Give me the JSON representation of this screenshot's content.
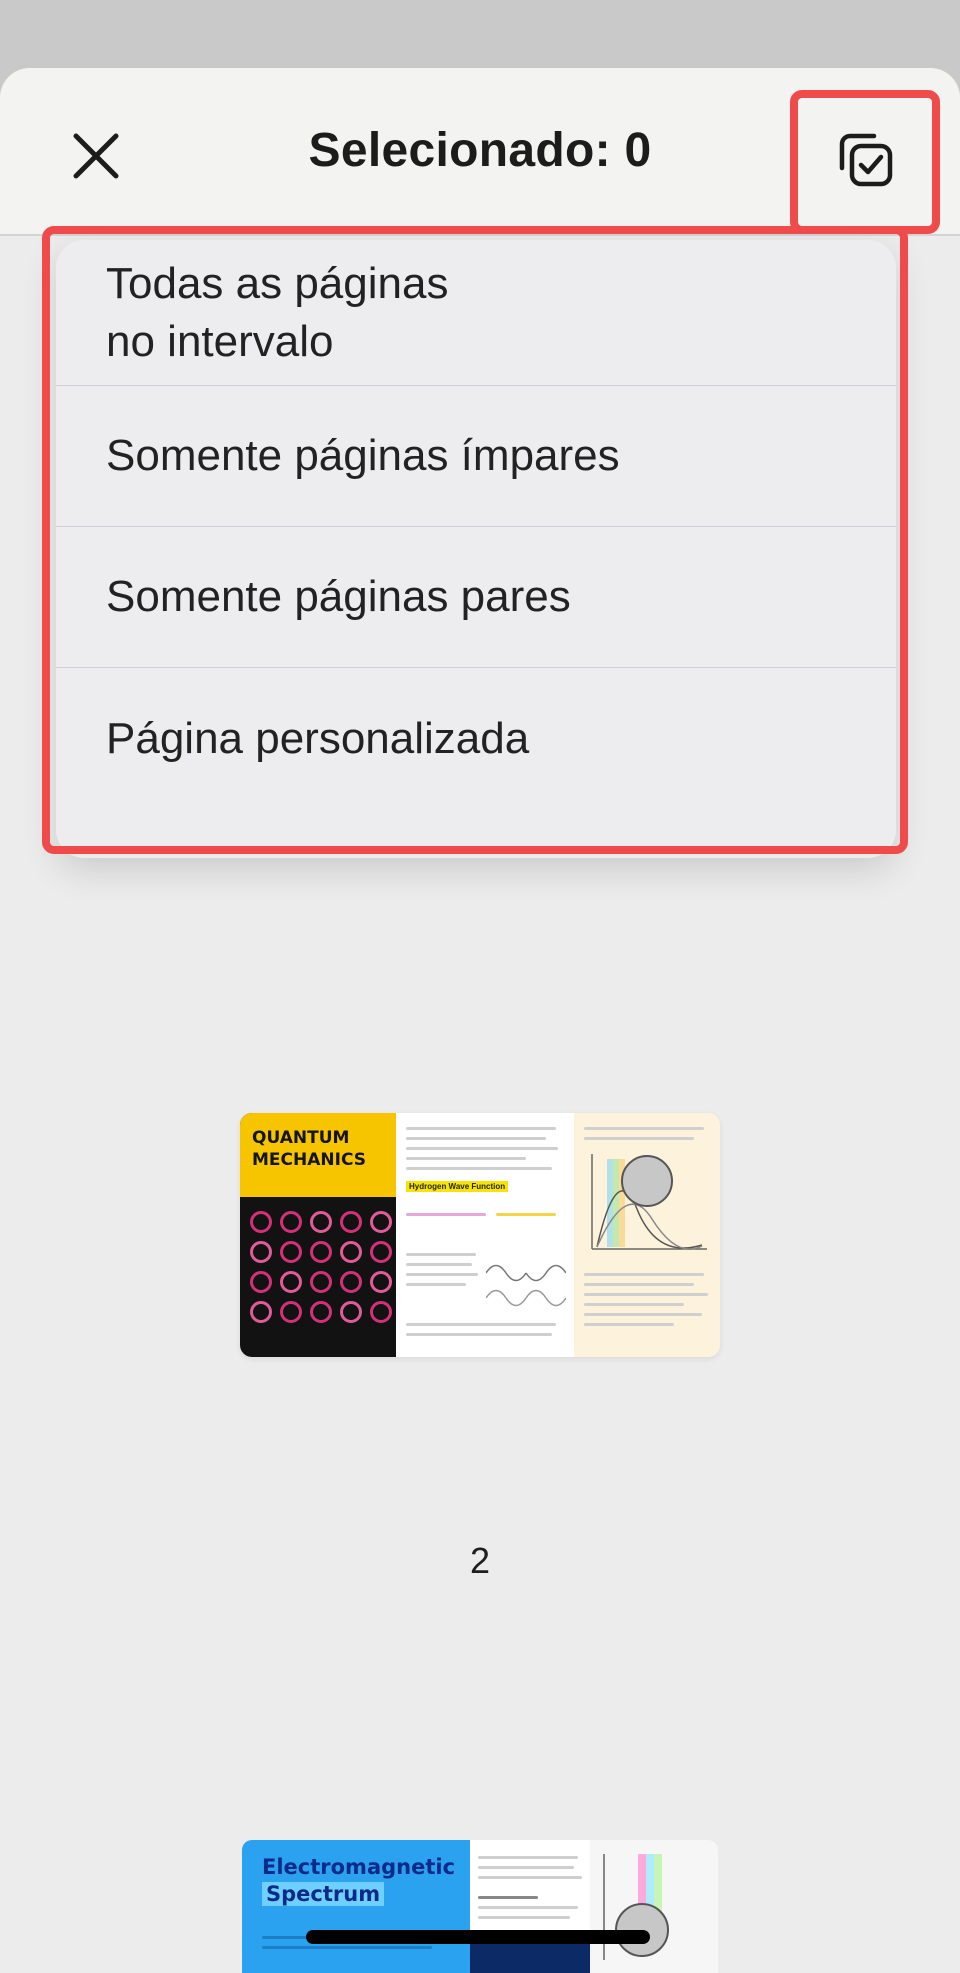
{
  "header": {
    "title": "Selecionado: 0",
    "close_icon": "close-icon",
    "select_icon": "select-pages-icon"
  },
  "menu": {
    "items": [
      {
        "line1": "Todas as páginas",
        "line2": "no intervalo"
      },
      {
        "label": "Somente páginas ímpares"
      },
      {
        "label": "Somente páginas pares"
      },
      {
        "label": "Página personalizada"
      }
    ]
  },
  "pages": {
    "page1": {
      "heading_line1": "QUANTUM",
      "heading_line2": "MECHANICS",
      "section_label": "Hydrogen Wave Function"
    },
    "page2": {
      "number_label": "2",
      "heading_line1": "Electromagnetic",
      "heading_line2": "Spectrum"
    }
  },
  "colors": {
    "highlight": "#f04b4b",
    "sheet_background": "#ececec",
    "menu_background": "#ededf0"
  }
}
